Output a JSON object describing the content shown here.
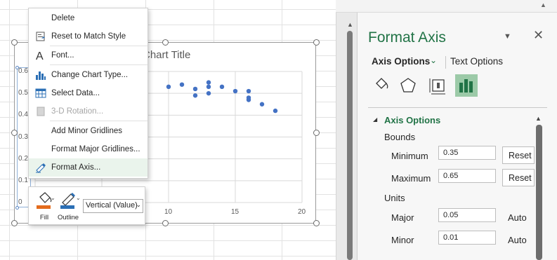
{
  "chart": {
    "title": "Chart Title",
    "y_ticks": [
      "0.6",
      "0.5",
      "0.4",
      "0.3",
      "0.2",
      "0.1",
      "0"
    ],
    "x_ticks": [
      "10",
      "15",
      "20"
    ]
  },
  "chart_data": {
    "type": "scatter",
    "title": "Chart Title",
    "xlim": [
      0,
      20
    ],
    "ylim": [
      0,
      0.6
    ],
    "grid": true,
    "series": [
      {
        "x": [
          10,
          11,
          12,
          12,
          13,
          13,
          13,
          14,
          15,
          16,
          16,
          16,
          17,
          18
        ],
        "y": [
          0.53,
          0.54,
          0.52,
          0.49,
          0.55,
          0.53,
          0.5,
          0.53,
          0.51,
          0.51,
          0.48,
          0.47,
          0.45,
          0.42
        ]
      }
    ],
    "marker_color": "#4472c4"
  },
  "context_menu": {
    "items": [
      {
        "label": "Delete",
        "icon": "delete-icon",
        "enabled": true
      },
      {
        "label": "Reset to Match Style",
        "icon": "reset-style-icon",
        "enabled": true
      },
      {
        "label": "Font...",
        "icon": "font-icon",
        "enabled": true
      },
      {
        "label": "Change Chart Type...",
        "icon": "chart-type-icon",
        "enabled": true
      },
      {
        "label": "Select Data...",
        "icon": "select-data-icon",
        "enabled": true
      },
      {
        "label": "3-D Rotation...",
        "icon": "rotation-icon",
        "enabled": false
      },
      {
        "label": "Add Minor Gridlines",
        "icon": "",
        "enabled": true
      },
      {
        "label": "Format Major Gridlines...",
        "icon": "",
        "enabled": true
      },
      {
        "label": "Format Axis...",
        "icon": "format-axis-icon",
        "enabled": true,
        "highlighted": true
      }
    ]
  },
  "mini_toolbar": {
    "fill_label": "Fill",
    "outline_label": "Outline",
    "element_select": "Vertical (Value)"
  },
  "format_pane": {
    "title": "Format Axis",
    "tab_axis_options": "Axis Options",
    "tab_text_options": "Text Options",
    "section": "Axis Options",
    "bounds_label": "Bounds",
    "minimum_label": "Minimum",
    "minimum_value": "0.35",
    "maximum_label": "Maximum",
    "maximum_value": "0.65",
    "reset_label": "Reset",
    "units_label": "Units",
    "major_label": "Major",
    "major_value": "0.05",
    "minor_label": "Minor",
    "minor_value": "0.01",
    "auto_label": "Auto",
    "accent_color": "#217346"
  }
}
